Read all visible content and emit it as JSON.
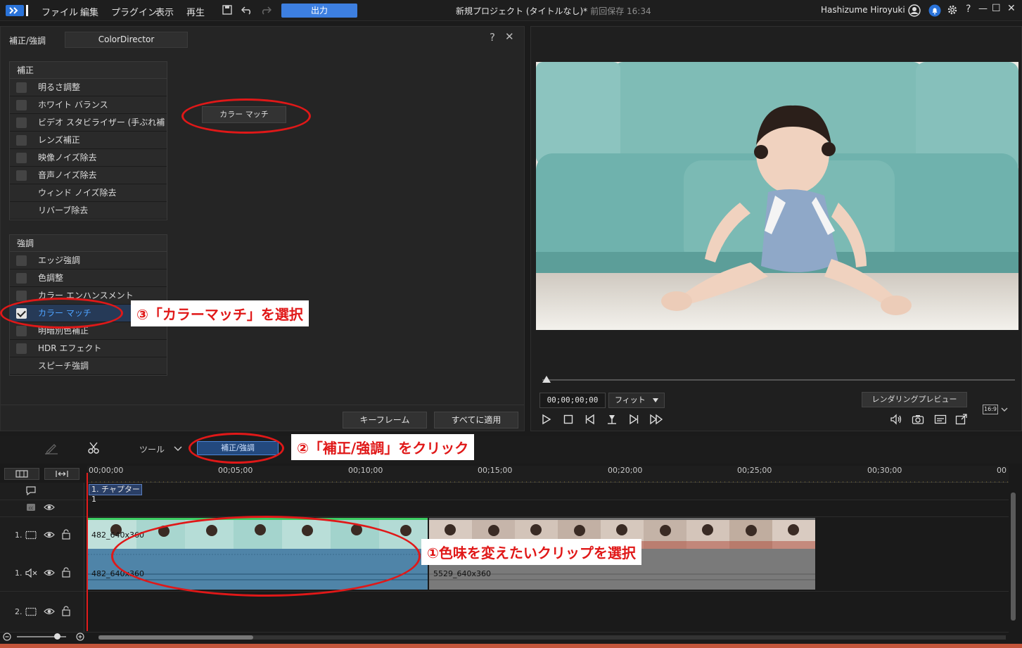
{
  "menubar": {
    "items": [
      "ファイル",
      "編集",
      "プラグイン",
      "表示",
      "再生"
    ],
    "output_button": "出力",
    "project_title": "新規プロジェクト (タイトルなし)*",
    "save_status": "前回保存 16:34",
    "user_name": "Hashizume Hiroyuki",
    "window_controls": [
      "?",
      "—",
      "☐",
      "✕"
    ]
  },
  "fix_panel": {
    "title": "補正/強調",
    "tab": "ColorDirector",
    "help": "?",
    "close": "✕",
    "section_fix": {
      "header": "補正",
      "items": [
        {
          "label": "明るさ調整",
          "checkbox": true
        },
        {
          "label": "ホワイト バランス",
          "checkbox": true
        },
        {
          "label": "ビデオ スタビライザー (手ぶれ補正)",
          "checkbox": true
        },
        {
          "label": "レンズ補正",
          "checkbox": true
        },
        {
          "label": "映像ノイズ除去",
          "checkbox": true
        },
        {
          "label": "音声ノイズ除去",
          "checkbox": true
        },
        {
          "label": "ウィンド ノイズ除去",
          "checkbox": false
        },
        {
          "label": "リバーブ除去",
          "checkbox": false
        }
      ]
    },
    "section_enhance": {
      "header": "強調",
      "items": [
        {
          "label": "エッジ強調",
          "checkbox": true,
          "checked": false
        },
        {
          "label": "色調整",
          "checkbox": true,
          "checked": false
        },
        {
          "label": "カラー エンハンスメント",
          "checkbox": true,
          "checked": false
        },
        {
          "label": "カラー マッチ",
          "checkbox": true,
          "checked": true
        },
        {
          "label": "明暗別色補正",
          "checkbox": true,
          "checked": false
        },
        {
          "label": "HDR エフェクト",
          "checkbox": true,
          "checked": false
        },
        {
          "label": "スピーチ強調",
          "checkbox": false,
          "checked": false
        }
      ]
    },
    "color_match_button": "カラー マッチ",
    "keyframe_button": "キーフレーム",
    "apply_all_button": "すべてに適用"
  },
  "preview": {
    "timecode": "00;00;00;00",
    "fit_option": "フィット",
    "render_preview_button": "レンダリングプレビュー",
    "aspect_ratio": "16:9"
  },
  "toolbar": {
    "tools_label": "ツール",
    "fix_enhance_button": "補正/強調"
  },
  "timeline": {
    "ruler_ticks": [
      "00;00;00",
      "00;05;00",
      "00;10;00",
      "00;15;00",
      "00;20;00",
      "00;25;00",
      "00;30;00",
      "00"
    ],
    "chapter_label": "1. チャプター 1",
    "tracks": [
      {
        "label": "1.",
        "kind": "video"
      },
      {
        "label": "1.",
        "kind": "audio"
      },
      {
        "label": "2.",
        "kind": "video"
      }
    ],
    "clips": [
      {
        "video_label": "482_640x360",
        "audio_label": "482_640x360",
        "selected": true
      },
      {
        "video_label": "5529_640x360",
        "audio_label": "5529_640x360",
        "selected": false
      }
    ]
  },
  "annotations": {
    "step1": "①色味を変えたいクリップを選択",
    "step2": "②「補正/強調」をクリック",
    "step3": "③「カラーマッチ」を選択"
  },
  "colors": {
    "accent": "#3d7fe0",
    "annotation_red": "#e01818",
    "selected_clip": "#4f84a8",
    "clip_top_green": "#3ccc62"
  }
}
